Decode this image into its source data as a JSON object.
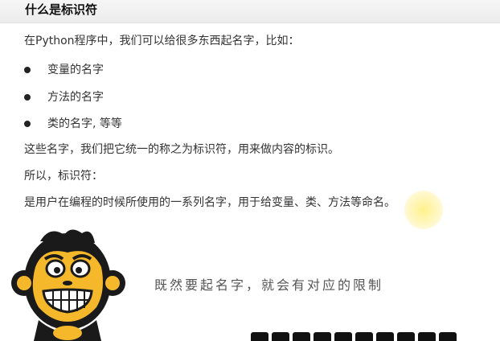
{
  "slide": {
    "title": "什么是标识符",
    "intro": "在Python程序中，我们可以给很多东西起名字，比如：",
    "bullets": [
      "变量的名字",
      "方法的名字",
      "类的名字, 等等"
    ],
    "summary": "这些名字，我们把它统一的称之为标识符，用来做内容的标识。",
    "so_label": "所以，标识符：",
    "definition": "是用户在编程的时候所使用的一系列名字，用于给变量、类、方法等命名。",
    "caption": "既然要起名字，就会有对应的限制"
  },
  "colors": {
    "title_bar": "#eeeeee",
    "text": "#333333",
    "highlight": "#ffe97a",
    "mascot_face": "#f5b82a",
    "mascot_fur": "#1a1a1a"
  }
}
